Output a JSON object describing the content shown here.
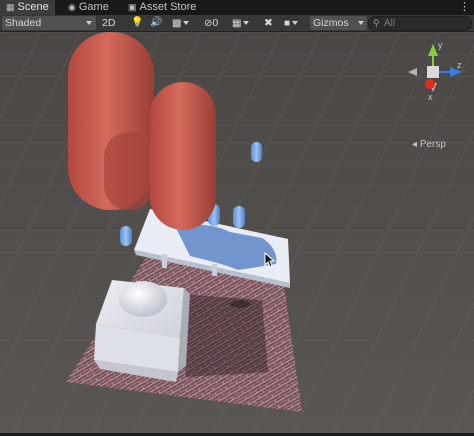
{
  "tabs": [
    {
      "label": "Scene",
      "icon": "grid-icon",
      "active": true
    },
    {
      "label": "Game",
      "icon": "gamepad-icon",
      "active": false
    },
    {
      "label": "Asset Store",
      "icon": "bag-icon",
      "active": false
    }
  ],
  "tab_menu_icon": "more-vertical-icon",
  "toolbar": {
    "shading_mode": "Shaded",
    "mode_2d": "2D",
    "hidden_count": "0",
    "gizmos": "Gizmos",
    "search_placeholder": "All"
  },
  "scene_gizmo": {
    "axis_y": "y",
    "axis_z": "z",
    "axis_x": "x",
    "projection": "Persp"
  },
  "colors": {
    "x_axis": "#e0291f",
    "y_axis": "#8ccc3a",
    "z_axis": "#3a7ee4",
    "toolbar": "#383838",
    "tab_bar": "#191919"
  }
}
